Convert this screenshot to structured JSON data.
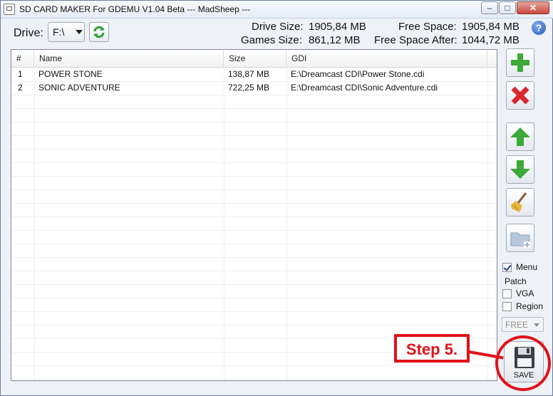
{
  "window": {
    "title": "SD CARD MAKER For GDEMU  V1.04 Beta ---  MadSheep ---",
    "minimize_glyph": "–",
    "maximize_glyph": "□",
    "close_glyph": "✕"
  },
  "drive": {
    "label": "Drive:",
    "selected": "F:\\"
  },
  "stats": {
    "drive_size_label": "Drive Size:",
    "drive_size_value": "1905,84 MB",
    "games_size_label": "Games Size:",
    "games_size_value": "861,12 MB",
    "free_space_label": "Free Space:",
    "free_space_value": "1905,84 MB",
    "free_space_after_label": "Free Space After:",
    "free_space_after_value": "1044,72 MB"
  },
  "help": {
    "glyph": "?"
  },
  "table": {
    "headers": [
      "#",
      "Name",
      "Size",
      "GDI"
    ],
    "rows": [
      {
        "num": "1",
        "name": "POWER STONE",
        "size": "138,87 MB",
        "gdi": "E:\\Dreamcast CDI\\Power Stone.cdi"
      },
      {
        "num": "2",
        "name": "SONIC ADVENTURE",
        "size": "722,25 MB",
        "gdi": "E:\\Dreamcast CDI\\Sonic Adventure.cdi"
      }
    ]
  },
  "side_buttons": [
    "add-icon",
    "remove-icon",
    "move-up-icon",
    "move-down-icon",
    "clean-broom-icon",
    "add-folder-icon"
  ],
  "options": {
    "menu_label": "Menu",
    "menu_checked": true,
    "patch_label": "Patch",
    "vga_label": "VGA",
    "vga_checked": false,
    "region_label": "Region",
    "region_checked": false,
    "region_select_value": "FREE"
  },
  "save": {
    "label": "SAVE"
  },
  "annotation": {
    "step_text": "Step 5.",
    "color": "#e0121a"
  }
}
